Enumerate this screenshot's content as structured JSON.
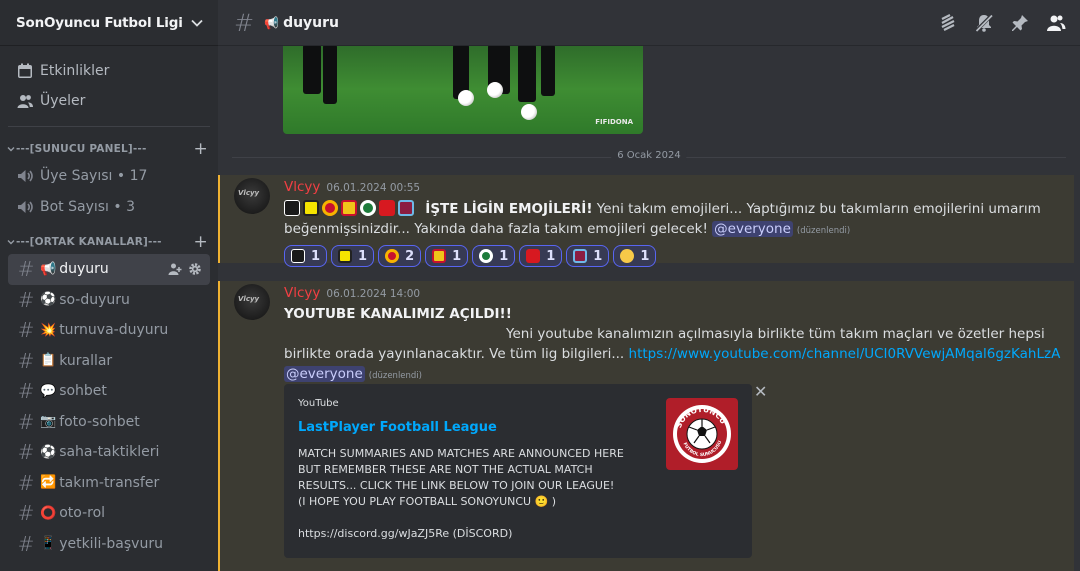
{
  "server": {
    "name": "SonOyuncu Futbol Ligi"
  },
  "nav": [
    {
      "label": "Etkinlikler",
      "icon": "calendar-icon"
    },
    {
      "label": "Üyeler",
      "icon": "members-icon"
    }
  ],
  "categories": [
    {
      "label": "---[SUNUCU PANEL]---"
    },
    {
      "label": "---[ORTAK KANALLAR]---"
    }
  ],
  "voice_channels": [
    {
      "label": "Üye Sayısı • 17"
    },
    {
      "label": "Bot Sayısı • 3"
    }
  ],
  "channels": [
    {
      "emoji": "📢",
      "label": "duyuru"
    },
    {
      "emoji": "⚽",
      "label": "so-duyuru"
    },
    {
      "emoji": "💥",
      "label": "turnuva-duyuru"
    },
    {
      "emoji": "📋",
      "label": "kurallar"
    },
    {
      "emoji": "💬",
      "label": "sohbet"
    },
    {
      "emoji": "📷",
      "label": "foto-sohbet"
    },
    {
      "emoji": "⚽",
      "label": "saha-taktikleri"
    },
    {
      "emoji": "🔁",
      "label": "takım-transfer"
    },
    {
      "emoji": "⭕",
      "label": "oto-rol"
    },
    {
      "emoji": "📱",
      "label": "yetkili-başvuru"
    }
  ],
  "topbar": {
    "channel_emoji": "📢",
    "channel": "duyuru"
  },
  "video": {
    "watermark": "FIFIDONA"
  },
  "date_separator": "6 Ocak 2024",
  "messages": [
    {
      "author": "Vlcyy",
      "timestamp": "06.01.2024 00:55",
      "bold": "İŞTE LİGİN EMOJİLERİ!",
      "text1": " Yeni takım emojileri... Yaptığımız bu takımların emojilerini umarım",
      "text2": "beğenmişsinizdir... Yakında daha fazla takım emojileri gelecek! ",
      "mention": "@everyone",
      "edited": "(düzenlendi)",
      "reaction_counts": [
        "1",
        "1",
        "2",
        "1",
        "1",
        "1",
        "1",
        "1"
      ]
    },
    {
      "author": "Vlcyy",
      "timestamp": "06.01.2024 14:00",
      "title": "YOUTUBE KANALIMIZ AÇILDI!!",
      "text1": "Yeni youtube kanalımızın açılmasıyla birlikte tüm takım maçları ve özetler hepsi",
      "text2": "birlikte orada yayınlanacaktır. Ve tüm lig bilgileri... ",
      "link": "https://www.youtube.com/channel/UCI0RVVewjAMqal6gzKahLzA",
      "mention": "@everyone",
      "edited": "(düzenlendi)",
      "embed": {
        "provider": "YouTube",
        "title": "LastPlayer Football League",
        "description": "MATCH SUMMARIES AND MATCHES ARE ANNOUNCED HERE\nBUT REMEMBER THESE ARE NOT THE ACTUAL MATCH\nRESULTS... CLICK THE LINK BELOW TO JOIN OUR LEAGUE!\n(I HOPE YOU PLAY FOOTBALL SONOYUNCU 🙂 )\n\nhttps://discord.gg/wJaZJ5Re (DİSCORD)",
        "logo_top": "SONOYUNCU",
        "logo_bottom": "FUTBOL SUNUCUSU"
      }
    }
  ],
  "colors": {
    "accent": "#5865f2",
    "highlight_border": "#f0b232",
    "username": "#f23f43",
    "link": "#00a8fc"
  }
}
